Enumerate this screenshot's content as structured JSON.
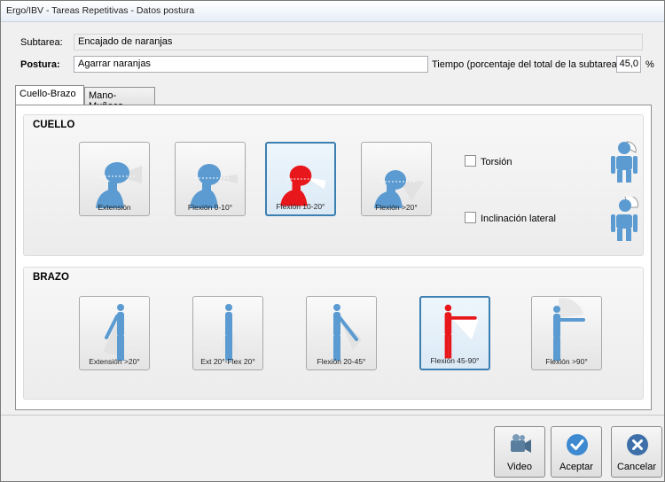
{
  "window": {
    "title": "Ergo/IBV - Tareas Repetitivas - Datos postura"
  },
  "form": {
    "subtarea_label": "Subtarea:",
    "subtarea_value": "Encajado de naranjas",
    "postura_label": "Postura:",
    "postura_value": "Agarrar naranjas",
    "tiempo_label": "Tiempo (porcentaje del total de la subtarea):",
    "tiempo_value": "45,0",
    "tiempo_unit": "%"
  },
  "tabs": [
    {
      "label": "Cuello-Brazo",
      "active": true
    },
    {
      "label": "Mano-Muñeca",
      "active": false
    }
  ],
  "cuello": {
    "title": "CUELLO",
    "options": [
      {
        "label": "Extensión",
        "selected": false
      },
      {
        "label": "Flexión 0-10°",
        "selected": false
      },
      {
        "label": "Flexión 10-20°",
        "selected": true
      },
      {
        "label": "Flexión >20°",
        "selected": false
      }
    ],
    "checks": [
      {
        "label": "Torsión",
        "checked": false,
        "icon": "neck-twist-icon"
      },
      {
        "label": "Inclinación lateral",
        "checked": false,
        "icon": "neck-tilt-icon"
      }
    ]
  },
  "brazo": {
    "title": "BRAZO",
    "options": [
      {
        "label": "Extensión >20°",
        "selected": false
      },
      {
        "label": "Ext 20°-Flex 20°",
        "selected": false
      },
      {
        "label": "Flexión 20-45°",
        "selected": false
      },
      {
        "label": "Flexión 45-90°",
        "selected": true
      },
      {
        "label": "Flexión >90°",
        "selected": false
      }
    ]
  },
  "actions": {
    "video_label": "Video",
    "accept_label": "Aceptar",
    "cancel_label": "Cancelar"
  },
  "colors": {
    "figure_blue": "#5b9bd1",
    "selected_red": "#e8171b",
    "accent": "#3c7fb1"
  }
}
